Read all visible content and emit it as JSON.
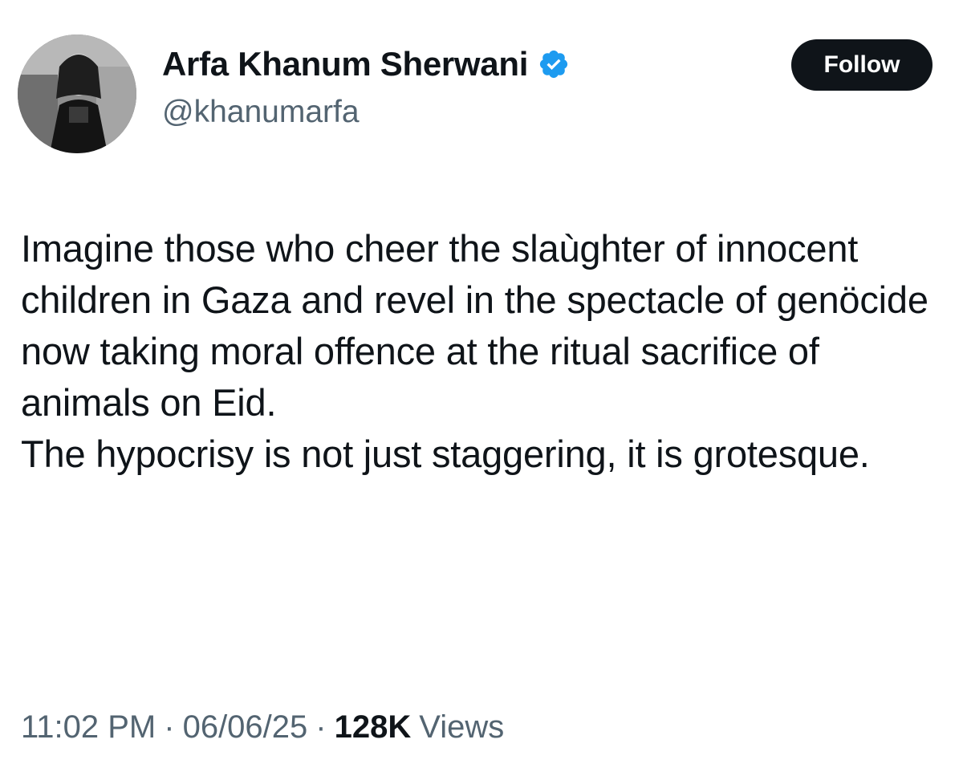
{
  "author": {
    "display_name": "Arfa Khanum Sherwani",
    "handle": "@khanumarfa",
    "verified": true,
    "verified_icon": "verified-badge-icon",
    "verified_color": "#1d9bf0"
  },
  "follow_button": {
    "label": "Follow"
  },
  "tweet": {
    "paragraphs": [
      "Imagine those who cheer the slaùghter of innocent children in Gaza and revel in the spectacle of genöcide now taking moral offence at the ritual sacrifice of animals on Eid.",
      "The hypocrisy is not just staggering, it is grotesque."
    ]
  },
  "meta": {
    "time": "11:02 PM",
    "date": "06/06/25",
    "separator": "·",
    "views_count": "128K",
    "views_label": "Views"
  },
  "colors": {
    "text_primary": "#0f1419",
    "text_secondary": "#536471",
    "button_bg": "#0f1419",
    "button_text": "#ffffff"
  }
}
